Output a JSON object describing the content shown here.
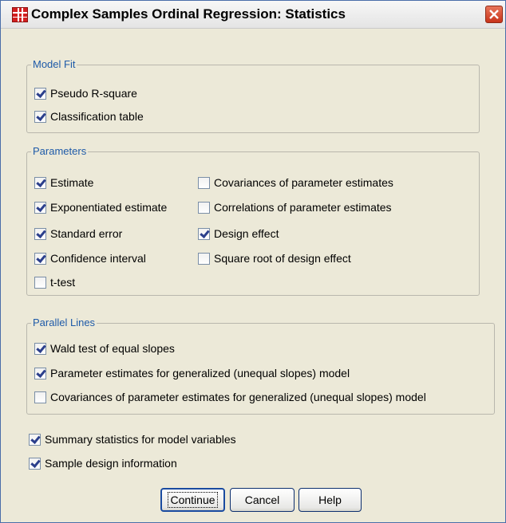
{
  "window": {
    "title": "Complex Samples Ordinal Regression: Statistics",
    "icon": "spss-grid-icon",
    "close_icon": "close-icon"
  },
  "groups": {
    "model_fit": {
      "legend": "Model Fit",
      "items": [
        {
          "label": "Pseudo R-square",
          "checked": true
        },
        {
          "label": "Classification table",
          "checked": true
        }
      ]
    },
    "parameters": {
      "legend": "Parameters",
      "items": [
        {
          "label": "Estimate",
          "checked": true
        },
        {
          "label": "Exponentiated estimate",
          "checked": true
        },
        {
          "label": "Standard error",
          "checked": true
        },
        {
          "label": "Confidence interval",
          "checked": true
        },
        {
          "label": "t-test",
          "checked": false
        },
        {
          "label": "Covariances of parameter estimates",
          "checked": false
        },
        {
          "label": "Correlations of parameter estimates",
          "checked": false
        },
        {
          "label": "Design effect",
          "checked": true
        },
        {
          "label": "Square root of design effect",
          "checked": false
        }
      ]
    },
    "parallel_lines": {
      "legend": "Parallel Lines",
      "items": [
        {
          "label": "Wald test of equal slopes",
          "checked": true
        },
        {
          "label": "Parameter estimates for generalized (unequal slopes) model",
          "checked": true
        },
        {
          "label": "Covariances of parameter estimates for generalized (unequal slopes) model",
          "checked": false
        }
      ]
    }
  },
  "bottom_options": [
    {
      "label": "Summary statistics for model variables",
      "checked": true
    },
    {
      "label": "Sample design information",
      "checked": true
    }
  ],
  "buttons": {
    "continue": "Continue",
    "cancel": "Cancel",
    "help": "Help"
  },
  "colors": {
    "dialog_bg": "#ece9d8",
    "legend_text": "#1e5aa8",
    "close_button": "#c8331a"
  }
}
